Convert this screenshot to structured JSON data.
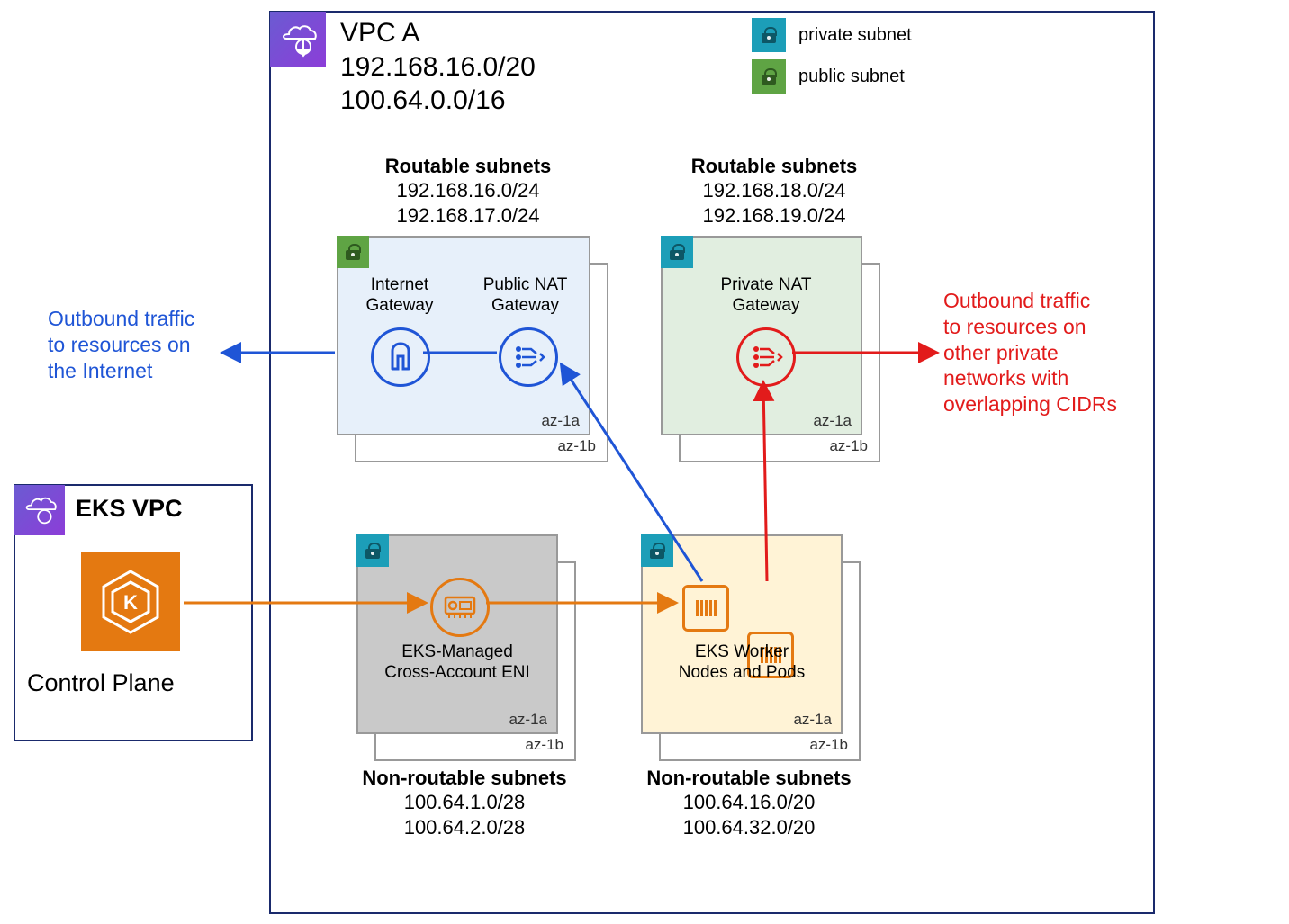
{
  "vpc_a": {
    "name": "VPC A",
    "cidr1": "192.168.16.0/20",
    "cidr2": "100.64.0.0/16"
  },
  "legend": {
    "private": "private subnet",
    "public": "public subnet"
  },
  "routable_left": {
    "heading": "Routable subnets",
    "cidr1": "192.168.16.0/24",
    "cidr2": "192.168.17.0/24",
    "igw": "Internet\nGateway",
    "nat": "Public NAT\nGateway",
    "az1": "az-1a",
    "az2": "az-1b"
  },
  "routable_right": {
    "heading": "Routable subnets",
    "cidr1": "192.168.18.0/24",
    "cidr2": "192.168.19.0/24",
    "pnat": "Private NAT\nGateway",
    "az1": "az-1a",
    "az2": "az-1b"
  },
  "nonroutable_left": {
    "heading": "Non-routable subnets",
    "cidr1": "100.64.1.0/28",
    "cidr2": "100.64.2.0/28",
    "eni": "EKS-Managed\nCross-Account ENI",
    "az1": "az-1a",
    "az2": "az-1b"
  },
  "nonroutable_right": {
    "heading": "Non-routable subnets",
    "cidr1": "100.64.16.0/20",
    "cidr2": "100.64.32.0/20",
    "nodes": "EKS Worker\nNodes and Pods",
    "az1": "az-1a",
    "az2": "az-1b"
  },
  "eks_vpc": {
    "name": "EKS VPC",
    "control_plane": "Control Plane"
  },
  "annot_left": "Outbound traffic\nto resources on\nthe Internet",
  "annot_right": "Outbound traffic\nto resources on\nother private\nnetworks with\noverlapping CIDRs",
  "colors": {
    "blue": "#1f55d6",
    "red": "#e21b1b",
    "orange": "#e47911",
    "teal": "#1c9eb8",
    "green": "#5fa444",
    "private_fill": "#e1eee0",
    "public_fill": "#e7f0fa",
    "worker_fill": "#fff3d6",
    "gray_fill": "#c9c9c9"
  }
}
